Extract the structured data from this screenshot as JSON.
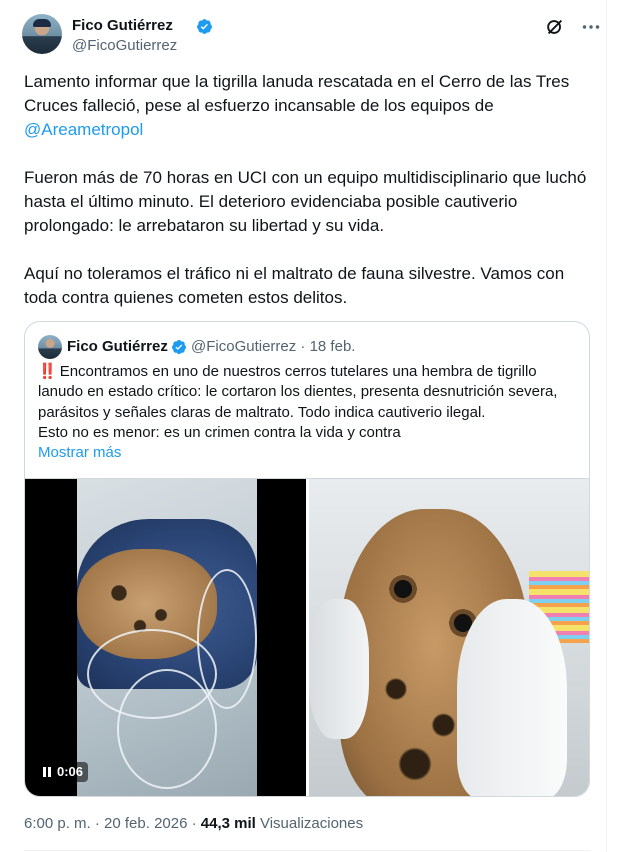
{
  "author": {
    "name": "Fico Gutiérrez",
    "handle": "@FicoGutierrez",
    "verified_color": "#1d9bf0"
  },
  "header_icons": [
    "grok-icon",
    "more-options-icon"
  ],
  "tweet": {
    "line1": "Lamento informar que la tigrilla lanuda rescatada en el Cerro de las Tres Cruces falleció, pese al esfuerzo incansable de los equipos de ",
    "mention": "@Areametropol",
    "para2": "Fueron más de 70 horas en UCI con un equipo multidisciplinario que luchó hasta el último minuto. El deterioro evidenciaba posible cautiverio prolongado: le arrebataron su libertad y su vida.",
    "para3": "Aquí no toleramos el tráfico ni el maltrato de fauna silvestre. Vamos con toda contra quienes cometen estos delitos."
  },
  "quote": {
    "name": "Fico Gutiérrez",
    "handle_date": "@FicoGutierrez · 18 feb.",
    "bang": "‼️",
    "text1": "Encontramos en uno de nuestros cerros tutelares una hembra de tigrillo lanudo en estado crítico: le cortaron los dientes, presenta desnutrición severa, parásitos y señales claras de maltrato. Todo indica cautiverio ilegal.",
    "text2": "Esto no es menor: es un crimen contra la vida y contra",
    "show_more": "Mostrar más",
    "video_time": "0:06"
  },
  "meta": {
    "timestamp": "6:00 p. m. · 20 feb. 2026 · ",
    "views_count": "44,3 mil",
    "views_label": " Visualizaciones"
  },
  "colors": {
    "link": "#1d9bf0",
    "text": "#0f1419",
    "secondary": "#536471",
    "border": "#cfd9de"
  }
}
